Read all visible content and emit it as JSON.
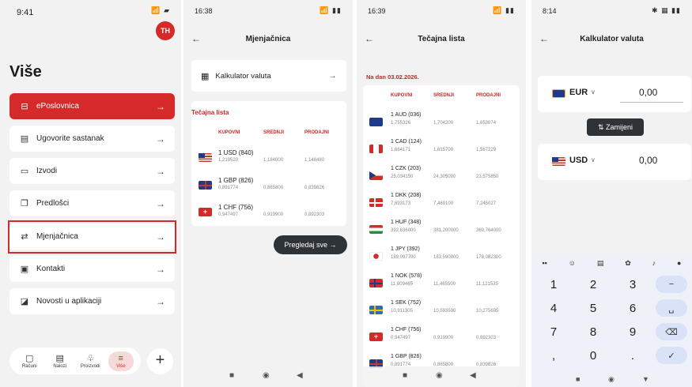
{
  "screen1": {
    "time": "9:41",
    "status_icons": "📶 ▰",
    "avatar": "TH",
    "title": "Više",
    "menu": [
      {
        "label": "ePoslovnica",
        "icon": "store-icon"
      },
      {
        "label": "Ugovorite sastanak",
        "icon": "calendar-icon"
      },
      {
        "label": "Izvodi",
        "icon": "document-icon"
      },
      {
        "label": "Predlošci",
        "icon": "templates-icon"
      },
      {
        "label": "Mjenjačnica",
        "icon": "exchange-icon"
      },
      {
        "label": "Kontakti",
        "icon": "contacts-icon"
      },
      {
        "label": "Novosti u aplikaciji",
        "icon": "news-icon"
      }
    ],
    "nav": [
      "Računi",
      "Nalozi",
      "Proizvodi",
      "Više"
    ],
    "fab": "+"
  },
  "screen2": {
    "time": "16:38",
    "status_icons": "📶 ▮▮",
    "title": "Mjenjačnica",
    "calc_label": "Kalkulator valuta",
    "rates_title": "Tečajna lista",
    "headers": [
      "KUPOVNI",
      "SREDNJI",
      "PRODAJNI"
    ],
    "rows": [
      {
        "cur": "1 USD (840)",
        "v1": "1,219520",
        "v2": "1,184000",
        "v3": "1,148480"
      },
      {
        "cur": "1 GBP (826)",
        "v1": "0,891774",
        "v2": "0,865800",
        "v3": "0,839826"
      },
      {
        "cur": "1 CHF (756)",
        "v1": "0,947497",
        "v2": "0,919900",
        "v3": "0,892303"
      }
    ],
    "button": "Pregledaj sve"
  },
  "screen3": {
    "time": "16:39",
    "status_icons": "📶 ▮▮",
    "title": "Tečajna lista",
    "date": "Na dan 03.02.2026.",
    "headers": [
      "KUPOVNI",
      "SREDNJI",
      "PRODAJNI"
    ],
    "rows": [
      {
        "cur": "1 AUD (036)",
        "v1": "1,755326",
        "v2": "1,704200",
        "v3": "1,653074"
      },
      {
        "cur": "1 CAD (124)",
        "v1": "1,664171",
        "v2": "1,615700",
        "v3": "1,567229"
      },
      {
        "cur": "1 CZK (203)",
        "v1": "25,034150",
        "v2": "24,305000",
        "v3": "23,575850"
      },
      {
        "cur": "1 DKK (208)",
        "v1": "7,693173",
        "v2": "7,469100",
        "v3": "7,245027"
      },
      {
        "cur": "1 HUF (348)",
        "v1": "392,636000",
        "v2": "381,200000",
        "v3": "369,764000"
      },
      {
        "cur": "1 JPY (392)",
        "v1": "189,097700",
        "v2": "183,590000",
        "v3": "178,082300"
      },
      {
        "cur": "1 NOK (578)",
        "v1": "11,809465",
        "v2": "11,465500",
        "v3": "11,121535"
      },
      {
        "cur": "1 SEK (752)",
        "v1": "10,911305",
        "v2": "10,593500",
        "v3": "10,275695"
      },
      {
        "cur": "1 CHF (756)",
        "v1": "0,947497",
        "v2": "0,919900",
        "v3": "0,892303"
      },
      {
        "cur": "1 GBP (826)",
        "v1": "0,891774",
        "v2": "0,865800",
        "v3": "0,839826"
      }
    ]
  },
  "screen4": {
    "time": "8:14",
    "status_icons": "✱ ▦ ▮▮",
    "title": "Kalkulator valuta",
    "from": {
      "code": "EUR",
      "amount": "0,00"
    },
    "swap": "Zamijeni",
    "to": {
      "code": "USD",
      "amount": "0,00"
    },
    "keys": [
      "1",
      "2",
      "3",
      "−",
      "4",
      "5",
      "6",
      "␣",
      "7",
      "8",
      "9",
      "⌫",
      ",",
      "0",
      ".",
      "✓"
    ]
  },
  "colors": {
    "accent": "#d62a2a",
    "dark_button": "#2e3338",
    "background": "#f2f2f2"
  }
}
